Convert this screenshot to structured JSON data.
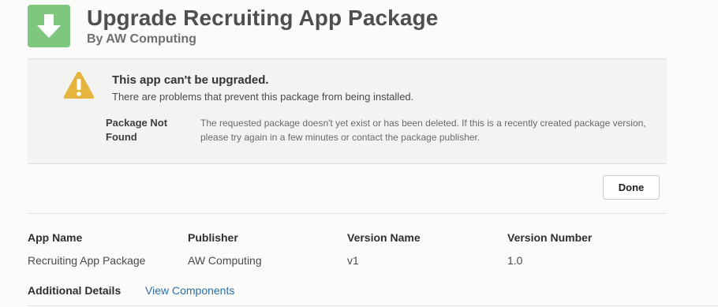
{
  "header": {
    "title": "Upgrade Recruiting App Package",
    "subtitle": "By AW Computing",
    "icon": "download-arrow-icon",
    "icon_color": "#7fc77f"
  },
  "error": {
    "icon": "warning-icon",
    "icon_color": "#e5b53d",
    "title": "This app can't be upgraded.",
    "description": "There are problems that prevent this package from being installed.",
    "detail_label": "Package Not Found",
    "detail_message": "The requested package doesn't yet exist or has been deleted. If this is a recently created package version, please try again in a few minutes or contact the package publisher."
  },
  "actions": {
    "done_label": "Done"
  },
  "package_info": {
    "columns": [
      {
        "header": "App Name",
        "value": "Recruiting App Package"
      },
      {
        "header": "Publisher",
        "value": "AW Computing"
      },
      {
        "header": "Version Name",
        "value": "v1"
      },
      {
        "header": "Version Number",
        "value": "1.0"
      }
    ]
  },
  "additional": {
    "label": "Additional Details",
    "link_label": "View Components",
    "link_color": "#2b6fa8"
  }
}
